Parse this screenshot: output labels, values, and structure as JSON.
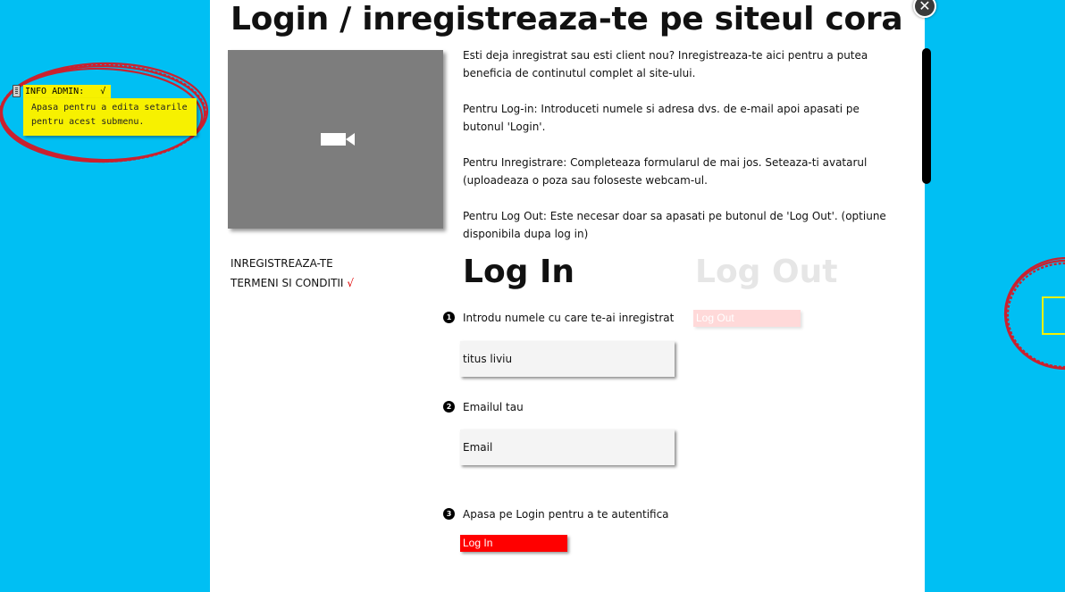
{
  "admin": {
    "tab_label": "INFO ADMIN:   √",
    "tooltip_line1": "Apasa pentru a edita setarile",
    "tooltip_line2": "pentru acest submenu."
  },
  "modal": {
    "title": "Login / inregistreaza-te pe siteul cora",
    "close_glyph": "✕",
    "video_icon": "video-camera-icon",
    "intro": [
      "Esti deja inregistrat sau esti client nou? Inregistreaza-te aici pentru a putea beneficia de continutul complet al site-ului.",
      "Pentru Log-in: Introduceti numele si adresa dvs. de e-mail apoi apasati pe butonul 'Login'.",
      "Pentru Inregistrare: Completeaza formularul de mai jos. Seteaza-ti avatarul (uploadeaza o poza sau foloseste webcam-ul.",
      "Pentru Log Out: Este necesar doar sa apasati pe butonul de 'Log Out'. (optiune disponibila dupa log in)"
    ],
    "links": {
      "register": "INREGISTREAZA-TE",
      "terms": "TERMENI SI CONDITII",
      "terms_check": "√"
    },
    "login": {
      "heading": "Log In",
      "steps": [
        {
          "num": "1",
          "label": "Introdu numele cu care te-ai inregistrat"
        },
        {
          "num": "2",
          "label": "Emailul tau"
        },
        {
          "num": "3",
          "label": "Apasa pe Login pentru a te autentifica"
        }
      ],
      "name_value": "titus liviu",
      "email_placeholder": "Email",
      "button": "Log In"
    },
    "logout": {
      "heading": "Log Out",
      "button": "Log Out"
    }
  },
  "colors": {
    "background": "#00bff3",
    "accent_red": "#ff0000",
    "note_yellow": "#f7f100",
    "scribble_red": "#e0101a"
  }
}
